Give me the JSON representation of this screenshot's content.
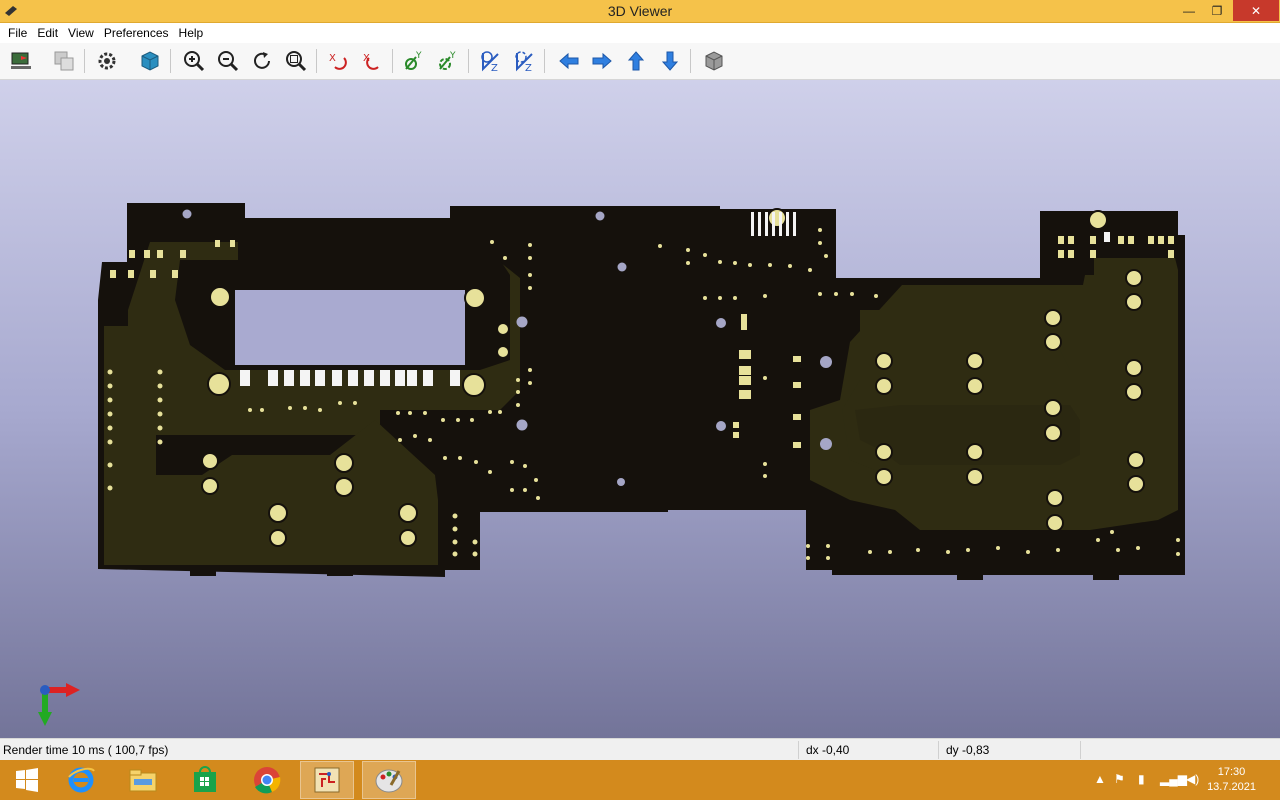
{
  "window": {
    "title": "3D Viewer",
    "minimize": "—",
    "maximize": "❐",
    "close": "✕"
  },
  "menu": {
    "items": [
      "File",
      "Edit",
      "View",
      "Preferences",
      "Help"
    ]
  },
  "toolbar": {
    "buttons": [
      "reload-board-icon",
      "copy-image-icon",
      "settings-icon",
      "raytrace-cube-icon",
      "zoom-in-icon",
      "zoom-out-icon",
      "redraw-icon",
      "zoom-fit-icon",
      "flip-x-clockwise-icon",
      "flip-x-counterclockwise-icon",
      "flip-y-clockwise-icon",
      "flip-y-counterclockwise-icon",
      "flip-z-clockwise-icon",
      "flip-z-counterclockwise-icon",
      "move-left-icon",
      "move-right-icon",
      "move-up-icon",
      "move-down-icon",
      "ortho-view-icon"
    ]
  },
  "colors": {
    "board_dark": "#15110c",
    "board_copper": "#2f2c12",
    "pad_gold": "#e7e19a",
    "hole": "#a5a6c6",
    "accent_arrow": "#2f7fe0"
  },
  "status": {
    "render": "Render time 10 ms ( 100,7 fps)",
    "dx": "dx -0,40",
    "dy": "dy -0,83"
  },
  "taskbar": {
    "apps": [
      "start-icon",
      "internet-explorer-icon",
      "file-explorer-icon",
      "store-icon",
      "chrome-icon",
      "kicad-pcbnew-icon",
      "kicad-3d-viewer-icon"
    ],
    "clock_time": "17:30",
    "clock_date": "13.7.2021"
  }
}
